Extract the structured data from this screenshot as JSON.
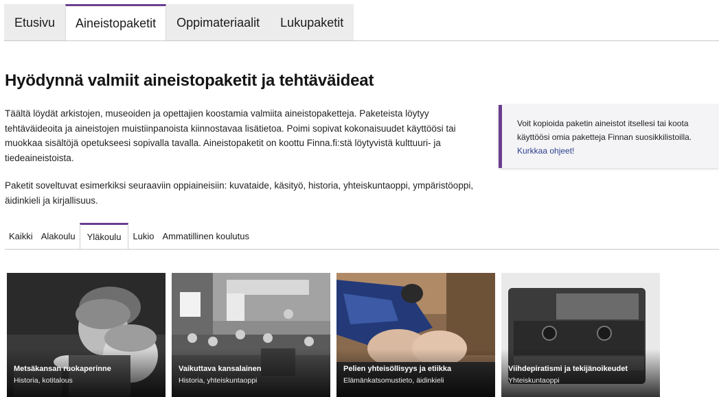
{
  "top_tabs": [
    {
      "label": "Etusivu",
      "active": false
    },
    {
      "label": "Aineistopaketit",
      "active": true
    },
    {
      "label": "Oppimateriaalit",
      "active": false
    },
    {
      "label": "Lukupaketit",
      "active": false
    }
  ],
  "heading": "Hyödynnä valmiit aineistopaketit ja tehtäväideat",
  "intro": {
    "p1": "Täältä löydät arkistojen, museoiden ja opettajien koostamia valmiita aineistopaketteja. Paketeista löytyy tehtäväideoita ja aineistojen muistiinpanoista kiinnostavaa lisätietoa. Poimi sopivat kokonaisuudet käyttöösi tai muokkaa sisältöjä opetukseesi sopivalla tavalla. Aineistopaketit on koottu Finna.fi:stä löytyvistä kulttuuri- ja tiedeaineistoista.",
    "p2": "Paketit soveltuvat esimerkiksi seuraaviin oppiaineisiin: kuvataide, käsityö, historia, yhteiskuntaoppi, ympäristöoppi, äidinkieli ja kirjallisuus."
  },
  "info_box": {
    "text": "Voit kopioida paketin aineistot itsellesi tai koota käyttöösi omia paketteja Finnan suosikkilistoilla.",
    "link": "Kurkkaa ohjeet!"
  },
  "sub_tabs": [
    {
      "label": "Kaikki",
      "active": false
    },
    {
      "label": "Alakoulu",
      "active": false
    },
    {
      "label": "Yläkoulu",
      "active": true
    },
    {
      "label": "Lukio",
      "active": false
    },
    {
      "label": "Ammatillinen koulutus",
      "active": false
    }
  ],
  "cards": [
    {
      "title": "Metsäkansan ruokaperinne",
      "subjects": "Historia, kotitalous"
    },
    {
      "title": "Vaikuttava kansalainen",
      "subjects": "Historia, yhteiskuntaoppi"
    },
    {
      "title": "Pelien yhteisöllisyys ja etiikka",
      "subjects": "Elämänkatsomustieto, äidinkieli"
    },
    {
      "title": "Viihdepiratismi ja tekijänoikeudet",
      "subjects": "Yhteiskuntaoppi"
    }
  ],
  "colors": {
    "accent": "#6a3d8f",
    "link": "#2c3f8f"
  }
}
